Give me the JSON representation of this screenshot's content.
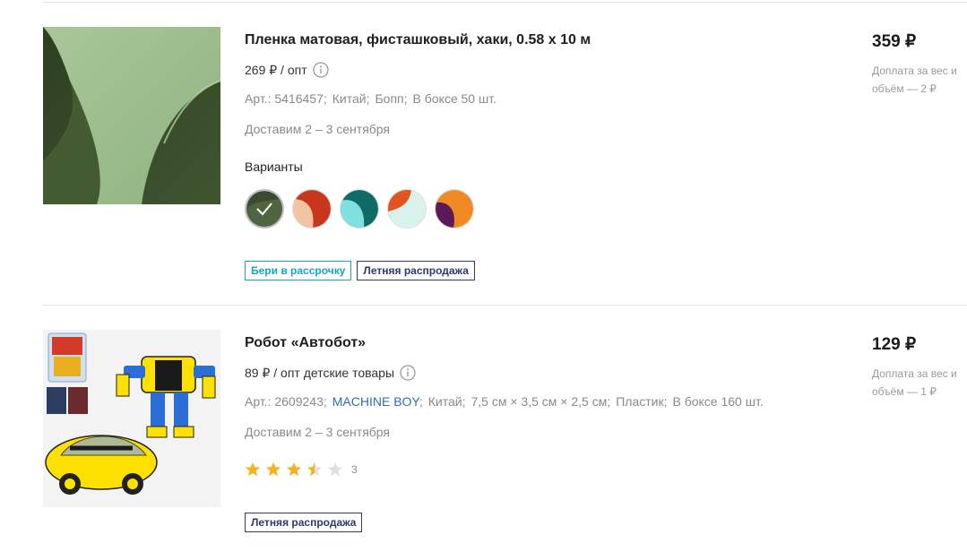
{
  "products": [
    {
      "title": "Пленка матовая, фисташковый, хаки, 0.58 x 10 м",
      "opt_price": "269 ₽ / опт",
      "article": "Арт.: 5416457;",
      "country": "Китай;",
      "material": "Бопп;",
      "box": "В боксе 50 шт.",
      "delivery": "Доставим 2 – 3 сентября",
      "variants_label": "Варианты",
      "variants": [
        {
          "name": "khaki-pistachio",
          "colors": [
            "#3b4a30",
            "#52683d"
          ]
        },
        {
          "name": "peach-red",
          "colors": [
            "#f3c4a4",
            "#c8361d"
          ]
        },
        {
          "name": "teal-mint",
          "colors": [
            "#0f6b66",
            "#7fe0e0"
          ]
        },
        {
          "name": "orange-mint",
          "colors": [
            "#d9f3ec",
            "#e2541d"
          ]
        },
        {
          "name": "purple-orange",
          "colors": [
            "#5a1a5a",
            "#f08a24"
          ]
        }
      ],
      "tags": [
        "Бери в рассрочку",
        "Летняя распродажа"
      ],
      "price": "359 ₽",
      "surcharge": "Доплата за вес и объём — 2 ₽"
    },
    {
      "title": "Робот «Автобот»",
      "opt_price": "89 ₽ / опт детские товары",
      "article": "Арт.: 2609243;",
      "brand": "MACHINE BOY",
      "country": "Китай;",
      "size": "7,5 см × 3,5 см × 2,5 см;",
      "material": "Пластик;",
      "box": "В боксе 160 шт.",
      "delivery": "Доставим 2 – 3 сентября",
      "rating": 3.5,
      "rating_count": "3",
      "tags": [
        "Летняя распродажа"
      ],
      "price": "129 ₽",
      "surcharge": "Доплата за вес и объём — 1 ₽"
    }
  ],
  "colors": {
    "accent_teal": "#1aa6b7",
    "accent_navy": "#2d3a6b",
    "star": "#f4b31d",
    "link": "#2f6fb0"
  }
}
